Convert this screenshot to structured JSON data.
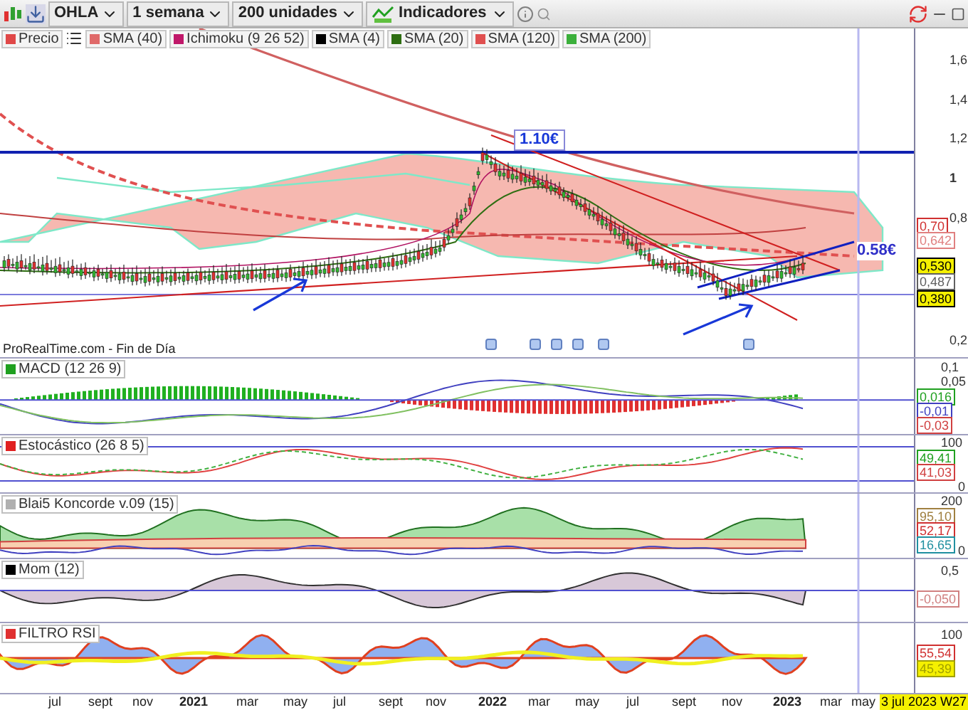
{
  "toolbar": {
    "symbol": "OHLA",
    "period": "1 semana",
    "units": "200 unidades",
    "indicators": "Indicadores"
  },
  "legend": [
    {
      "label": "Precio",
      "color": "#e04848"
    },
    {
      "label": "SMA (40)",
      "color": "#e06a6a"
    },
    {
      "label": "Ichimoku (9 26 52)",
      "color": "#c0186a"
    },
    {
      "label": "SMA (4)",
      "color": "#000000"
    },
    {
      "label": "SMA (20)",
      "color": "#2e6e12"
    },
    {
      "label": "SMA (120)",
      "color": "#e05050"
    },
    {
      "label": "SMA (200)",
      "color": "#3cb03c"
    }
  ],
  "main_chart": {
    "axis_labels": [
      "1,6",
      "1,4",
      "1,2",
      "1",
      "0,8",
      "0,2"
    ],
    "value_tags": [
      {
        "text": "0,70",
        "color": "#d03030",
        "highlighted": false
      },
      {
        "text": "0,642",
        "color": "#e08080",
        "highlighted": false
      },
      {
        "text": "0,530",
        "color": "#000000",
        "highlighted": true
      },
      {
        "text": "0,487",
        "color": "#606060",
        "highlighted": false
      },
      {
        "text": "0,380",
        "color": "#000000",
        "highlighted": true
      }
    ],
    "annotations": [
      "1.10€",
      "0.58€"
    ],
    "source": "ProRealTime.com - Fin de Día"
  },
  "panels": [
    {
      "kind": "macd",
      "title": "MACD (12 26 9)",
      "axis_labels": [
        "0,1",
        "0,05"
      ],
      "value_tags": [
        {
          "text": "0,016",
          "color": "#20a020",
          "highlighted": false
        },
        {
          "text": "-0,01",
          "color": "#4040c0",
          "highlighted": false
        },
        {
          "text": "-0,03",
          "color": "#d04040",
          "highlighted": false
        }
      ]
    },
    {
      "kind": "stoch",
      "title": "Estocástico (26 8 5)",
      "axis_labels": [
        "100",
        "0"
      ],
      "value_tags": [
        {
          "text": "49,41",
          "color": "#20a020",
          "highlighted": false
        },
        {
          "text": "41,03",
          "color": "#d04040",
          "highlighted": false
        }
      ]
    },
    {
      "kind": "koncorde",
      "title": "Blai5 Koncorde v.09 (15)",
      "axis_labels": [
        "200",
        "0"
      ],
      "value_tags": [
        {
          "text": "95,10",
          "color": "#a08040",
          "highlighted": false
        },
        {
          "text": "52,17",
          "color": "#d03030",
          "highlighted": false
        },
        {
          "text": "16,65",
          "color": "#2090a0",
          "highlighted": false
        }
      ]
    },
    {
      "kind": "mom",
      "title": "Mom (12)",
      "axis_labels": [
        "0,5"
      ],
      "value_tags": [
        {
          "text": "-0,050",
          "color": "#d08080",
          "highlighted": false
        }
      ]
    },
    {
      "kind": "rsi",
      "title": "FILTRO RSI",
      "axis_labels": [
        "100"
      ],
      "value_tags": [
        {
          "text": "55,54",
          "color": "#d03030",
          "highlighted": false
        },
        {
          "text": "45,39",
          "color": "#a0a000",
          "highlighted": true
        }
      ]
    }
  ],
  "x_axis": [
    {
      "label": "jul",
      "kind": "month"
    },
    {
      "label": "sept",
      "kind": "month"
    },
    {
      "label": "nov",
      "kind": "month"
    },
    {
      "label": "2021",
      "kind": "year"
    },
    {
      "label": "mar",
      "kind": "month"
    },
    {
      "label": "may",
      "kind": "month"
    },
    {
      "label": "jul",
      "kind": "month"
    },
    {
      "label": "sept",
      "kind": "month"
    },
    {
      "label": "nov",
      "kind": "month"
    },
    {
      "label": "2022",
      "kind": "year"
    },
    {
      "label": "mar",
      "kind": "month"
    },
    {
      "label": "may",
      "kind": "month"
    },
    {
      "label": "jul",
      "kind": "month"
    },
    {
      "label": "sept",
      "kind": "month"
    },
    {
      "label": "nov",
      "kind": "month"
    },
    {
      "label": "2023",
      "kind": "year"
    },
    {
      "label": "mar",
      "kind": "month"
    },
    {
      "label": "may",
      "kind": "month"
    }
  ],
  "cursor_date": "3 jul 2023 W27"
}
